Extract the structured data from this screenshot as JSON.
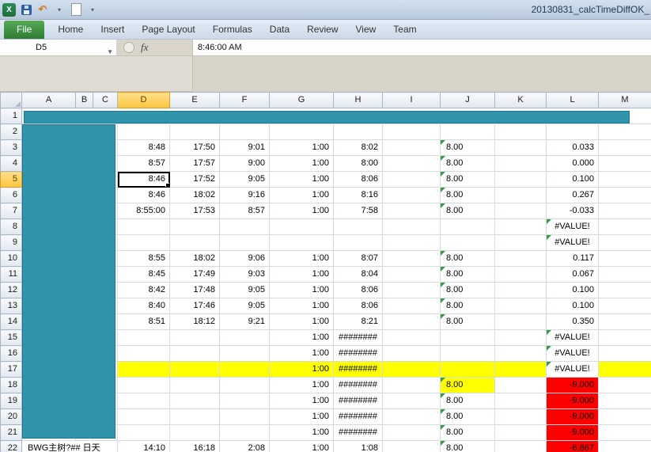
{
  "title_bar": {
    "title": "20130831_calcTimeDiffOK_",
    "app_icon_label": "X"
  },
  "ribbon": {
    "tabs": [
      {
        "label": "File",
        "style": "backstage"
      },
      {
        "label": "Home"
      },
      {
        "label": "Insert"
      },
      {
        "label": "Page Layout"
      },
      {
        "label": "Formulas"
      },
      {
        "label": "Data"
      },
      {
        "label": "Review"
      },
      {
        "label": "View"
      },
      {
        "label": "Team"
      }
    ]
  },
  "formula_bar": {
    "name_box_value": "D5",
    "function_label": "fx",
    "formula_value": "8:46:00 AM"
  },
  "sheet": {
    "selected_cell": "D5",
    "active_column": "D",
    "active_row": 5,
    "column_headers": [
      "A",
      "B",
      "C",
      "D",
      "E",
      "F",
      "G",
      "H",
      "I",
      "J",
      "K",
      "L",
      "M"
    ],
    "colors": {
      "redaction_fill": "#3095ab",
      "redaction_border": "#20768a",
      "highlight_yellow": "#ffff00",
      "error_red": "#ff0000",
      "selected_header": "#fcc63e",
      "error_indicator_green": "#3c9b3c"
    },
    "redactions": [
      {
        "name": "row-1-redaction-bar"
      },
      {
        "name": "left-column-redaction-block"
      }
    ],
    "rows": [
      {
        "n": 1,
        "bar": true
      },
      {
        "n": 2,
        "cells": []
      },
      {
        "n": 3,
        "cells": [
          {
            "c": "D",
            "v": "8:48"
          },
          {
            "c": "E",
            "v": "17:50"
          },
          {
            "c": "F",
            "v": "9:01"
          },
          {
            "c": "G",
            "v": "1:00"
          },
          {
            "c": "H",
            "v": "8:02"
          },
          {
            "c": "J",
            "v": "8.00",
            "tri": true,
            "align": "left"
          },
          {
            "c": "L",
            "v": "0.033"
          }
        ]
      },
      {
        "n": 4,
        "cells": [
          {
            "c": "D",
            "v": "8:57"
          },
          {
            "c": "E",
            "v": "17:57"
          },
          {
            "c": "F",
            "v": "9:00"
          },
          {
            "c": "G",
            "v": "1:00"
          },
          {
            "c": "H",
            "v": "8:00"
          },
          {
            "c": "J",
            "v": "8.00",
            "tri": true,
            "align": "left"
          },
          {
            "c": "L",
            "v": "0.000"
          }
        ]
      },
      {
        "n": 5,
        "cells": [
          {
            "c": "D",
            "v": "8:46"
          },
          {
            "c": "E",
            "v": "17:52"
          },
          {
            "c": "F",
            "v": "9:05"
          },
          {
            "c": "G",
            "v": "1:00"
          },
          {
            "c": "H",
            "v": "8:06"
          },
          {
            "c": "J",
            "v": "8.00",
            "tri": true,
            "align": "left"
          },
          {
            "c": "L",
            "v": "0.100"
          }
        ]
      },
      {
        "n": 6,
        "cells": [
          {
            "c": "D",
            "v": "8:46"
          },
          {
            "c": "E",
            "v": "18:02"
          },
          {
            "c": "F",
            "v": "9:16"
          },
          {
            "c": "G",
            "v": "1:00"
          },
          {
            "c": "H",
            "v": "8:16"
          },
          {
            "c": "J",
            "v": "8.00",
            "tri": true,
            "align": "left"
          },
          {
            "c": "L",
            "v": "0.267"
          }
        ]
      },
      {
        "n": 7,
        "cells": [
          {
            "c": "D",
            "v": "8:55:00"
          },
          {
            "c": "E",
            "v": "17:53"
          },
          {
            "c": "F",
            "v": "8:57"
          },
          {
            "c": "G",
            "v": "1:00"
          },
          {
            "c": "H",
            "v": "7:58"
          },
          {
            "c": "J",
            "v": "8.00",
            "tri": true,
            "align": "left"
          },
          {
            "c": "L",
            "v": "-0.033"
          }
        ]
      },
      {
        "n": 8,
        "cells": [
          {
            "c": "L",
            "v": "#VALUE!",
            "tri": true,
            "align": "center"
          }
        ]
      },
      {
        "n": 9,
        "cells": [
          {
            "c": "L",
            "v": "#VALUE!",
            "tri": true,
            "align": "center"
          }
        ]
      },
      {
        "n": 10,
        "cells": [
          {
            "c": "D",
            "v": "8:55"
          },
          {
            "c": "E",
            "v": "18:02"
          },
          {
            "c": "F",
            "v": "9:06"
          },
          {
            "c": "G",
            "v": "1:00"
          },
          {
            "c": "H",
            "v": "8:07"
          },
          {
            "c": "J",
            "v": "8.00",
            "tri": true,
            "align": "left"
          },
          {
            "c": "L",
            "v": "0.117"
          }
        ]
      },
      {
        "n": 11,
        "cells": [
          {
            "c": "D",
            "v": "8:45"
          },
          {
            "c": "E",
            "v": "17:49"
          },
          {
            "c": "F",
            "v": "9:03"
          },
          {
            "c": "G",
            "v": "1:00"
          },
          {
            "c": "H",
            "v": "8:04"
          },
          {
            "c": "J",
            "v": "8.00",
            "tri": true,
            "align": "left"
          },
          {
            "c": "L",
            "v": "0.067"
          }
        ]
      },
      {
        "n": 12,
        "cells": [
          {
            "c": "D",
            "v": "8:42"
          },
          {
            "c": "E",
            "v": "17:48"
          },
          {
            "c": "F",
            "v": "9:05"
          },
          {
            "c": "G",
            "v": "1:00"
          },
          {
            "c": "H",
            "v": "8:06"
          },
          {
            "c": "J",
            "v": "8.00",
            "tri": true,
            "align": "left"
          },
          {
            "c": "L",
            "v": "0.100"
          }
        ]
      },
      {
        "n": 13,
        "cells": [
          {
            "c": "D",
            "v": "8:40"
          },
          {
            "c": "E",
            "v": "17:46"
          },
          {
            "c": "F",
            "v": "9:05"
          },
          {
            "c": "G",
            "v": "1:00"
          },
          {
            "c": "H",
            "v": "8:06"
          },
          {
            "c": "J",
            "v": "8.00",
            "tri": true,
            "align": "left"
          },
          {
            "c": "L",
            "v": "0.100"
          }
        ]
      },
      {
        "n": 14,
        "cells": [
          {
            "c": "D",
            "v": "8:51"
          },
          {
            "c": "E",
            "v": "18:12"
          },
          {
            "c": "F",
            "v": "9:21"
          },
          {
            "c": "G",
            "v": "1:00"
          },
          {
            "c": "H",
            "v": "8:21"
          },
          {
            "c": "J",
            "v": "8.00",
            "tri": true,
            "align": "left"
          },
          {
            "c": "L",
            "v": "0.350"
          }
        ]
      },
      {
        "n": 15,
        "cells": [
          {
            "c": "G",
            "v": "1:00"
          },
          {
            "c": "H",
            "v": "########",
            "align": "center"
          },
          {
            "c": "L",
            "v": "#VALUE!",
            "tri": true,
            "align": "center"
          }
        ]
      },
      {
        "n": 16,
        "cells": [
          {
            "c": "G",
            "v": "1:00"
          },
          {
            "c": "H",
            "v": "########",
            "align": "center"
          },
          {
            "c": "L",
            "v": "#VALUE!",
            "tri": true,
            "align": "center"
          }
        ]
      },
      {
        "n": 17,
        "cells": [
          {
            "c": "D",
            "bg": "y"
          },
          {
            "c": "E",
            "bg": "y"
          },
          {
            "c": "F",
            "bg": "y"
          },
          {
            "c": "G",
            "v": "1:00",
            "bg": "y"
          },
          {
            "c": "H",
            "v": "########",
            "align": "center",
            "bg": "y"
          },
          {
            "c": "I",
            "bg": "y"
          },
          {
            "c": "J",
            "bg": "y"
          },
          {
            "c": "K",
            "bg": "y"
          },
          {
            "c": "L",
            "v": "#VALUE!",
            "tri": true,
            "align": "center"
          },
          {
            "c": "M",
            "bg": "y"
          }
        ]
      },
      {
        "n": 18,
        "cells": [
          {
            "c": "G",
            "v": "1:00"
          },
          {
            "c": "H",
            "v": "########",
            "align": "center"
          },
          {
            "c": "J",
            "v": "8.00",
            "tri": true,
            "align": "left",
            "bg": "y"
          },
          {
            "c": "L",
            "v": "-9.000",
            "bg": "r"
          }
        ]
      },
      {
        "n": 19,
        "cells": [
          {
            "c": "G",
            "v": "1:00"
          },
          {
            "c": "H",
            "v": "########",
            "align": "center"
          },
          {
            "c": "J",
            "v": "8.00",
            "tri": true,
            "align": "left"
          },
          {
            "c": "L",
            "v": "-9.000",
            "bg": "r"
          }
        ]
      },
      {
        "n": 20,
        "cells": [
          {
            "c": "G",
            "v": "1:00"
          },
          {
            "c": "H",
            "v": "########",
            "align": "center"
          },
          {
            "c": "J",
            "v": "8.00",
            "tri": true,
            "align": "left"
          },
          {
            "c": "L",
            "v": "-9.000",
            "bg": "r"
          }
        ]
      },
      {
        "n": 21,
        "cells": [
          {
            "c": "G",
            "v": "1:00"
          },
          {
            "c": "H",
            "v": "########",
            "align": "center"
          },
          {
            "c": "J",
            "v": "8.00",
            "tri": true,
            "align": "left"
          },
          {
            "c": "L",
            "v": "-9.000",
            "bg": "r"
          }
        ]
      },
      {
        "n": 22,
        "cells": [
          {
            "c": "A",
            "v": "BWG主树?## 日天",
            "align": "left",
            "span": 3
          },
          {
            "c": "D",
            "v": "14:10"
          },
          {
            "c": "E",
            "v": "16:18"
          },
          {
            "c": "F",
            "v": "2:08"
          },
          {
            "c": "G",
            "v": "1:00"
          },
          {
            "c": "H",
            "v": "1:08"
          },
          {
            "c": "J",
            "v": "8.00",
            "tri": true,
            "align": "left"
          },
          {
            "c": "L",
            "v": "-6.867",
            "bg": "r"
          }
        ]
      }
    ]
  }
}
